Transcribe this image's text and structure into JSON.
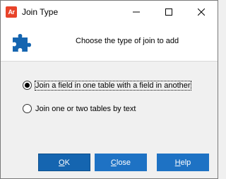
{
  "window": {
    "app_icon_text": "Ar",
    "app_icon_color": "#e8432a",
    "title": "Join Type",
    "controls": [
      "minimize-icon",
      "maximize-icon",
      "close-icon"
    ]
  },
  "header": {
    "icon": "puzzle-piece-icon",
    "icon_color": "#1565b0",
    "text": "Choose the type of join to add"
  },
  "options": [
    {
      "label": "Join a field in one table with a field in another",
      "checked": true
    },
    {
      "label": "Join one or two tables by text",
      "checked": false
    }
  ],
  "buttons": {
    "ok": {
      "mnemonic": "O",
      "rest": "K"
    },
    "close": {
      "mnemonic": "C",
      "rest": "lose"
    },
    "help": {
      "mnemonic": "H",
      "rest": "elp"
    }
  },
  "colors": {
    "button_bg": "#1e72c4",
    "button_default_bg": "#1565b0"
  }
}
